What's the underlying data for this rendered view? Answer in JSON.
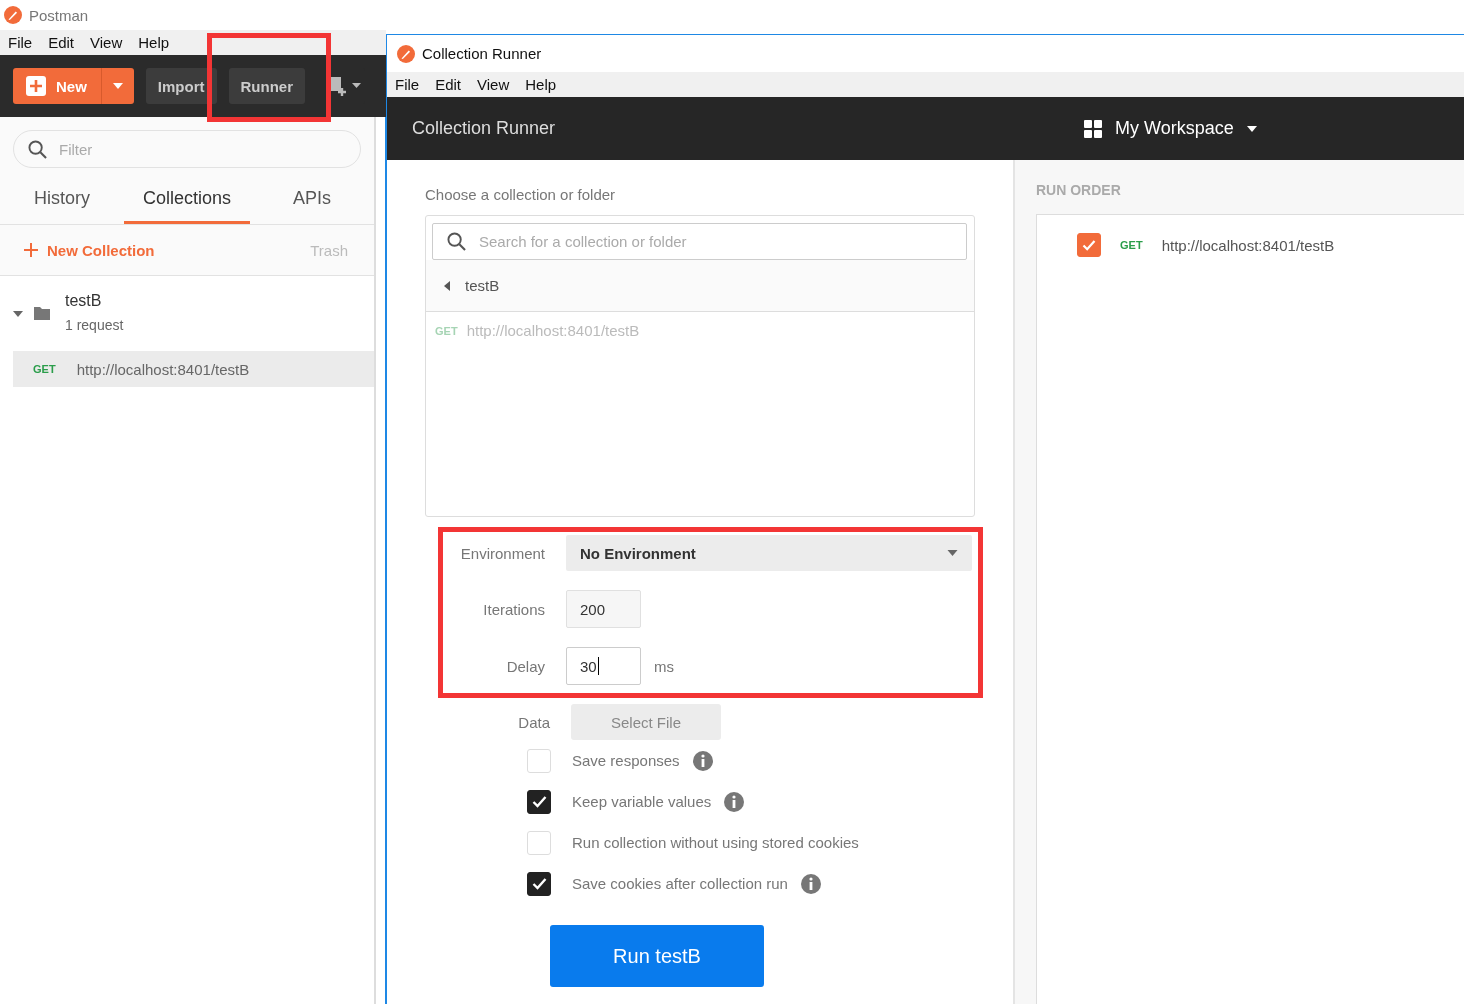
{
  "postman_window": {
    "title": "Postman",
    "menu": [
      "File",
      "Edit",
      "View",
      "Help"
    ],
    "toolbar": {
      "new_button": "New",
      "import_button": "Import",
      "runner_button": "Runner"
    },
    "sidebar": {
      "filter": {
        "placeholder": "Filter"
      },
      "tabs": [
        {
          "label": "History",
          "selected": false
        },
        {
          "label": "Collections",
          "selected": true
        },
        {
          "label": "APIs",
          "selected": false
        }
      ],
      "new_collection": "New Collection",
      "trash": "Trash",
      "collections": [
        {
          "name": "testB",
          "count": "1 request",
          "expanded": true,
          "requests": [
            {
              "method": "GET",
              "url": "http://localhost:8401/testB",
              "selected": true
            }
          ]
        }
      ]
    }
  },
  "runner_window": {
    "title": "Collection Runner",
    "menu": [
      "File",
      "Edit",
      "View",
      "Help"
    ],
    "header": {
      "title": "Collection Runner",
      "workspace": "My Workspace"
    },
    "chooser": {
      "heading": "Choose a collection or folder",
      "search": {
        "placeholder": "Search for a collection or folder"
      },
      "folder": "testB",
      "requests": [
        {
          "method": "GET",
          "url": "http://localhost:8401/testB"
        }
      ]
    },
    "settings": {
      "environment": {
        "label": "Environment",
        "value": "No Environment"
      },
      "iterations": {
        "label": "Iterations",
        "value": "200"
      },
      "delay": {
        "label": "Delay",
        "value": "30",
        "unit": "ms"
      },
      "data": {
        "label": "Data",
        "button": "Select File"
      }
    },
    "options": [
      {
        "label": "Save responses",
        "checked": false,
        "info": true
      },
      {
        "label": "Keep variable values",
        "checked": true,
        "info": true
      },
      {
        "label": "Run collection without using stored cookies",
        "checked": false,
        "info": false
      },
      {
        "label": "Save cookies after collection run",
        "checked": true,
        "info": true
      }
    ],
    "run_button": "Run testB",
    "run_order": {
      "heading": "RUN ORDER",
      "items": [
        {
          "method": "GET",
          "url": "http://localhost:8401/testB",
          "checked": true
        }
      ]
    }
  }
}
